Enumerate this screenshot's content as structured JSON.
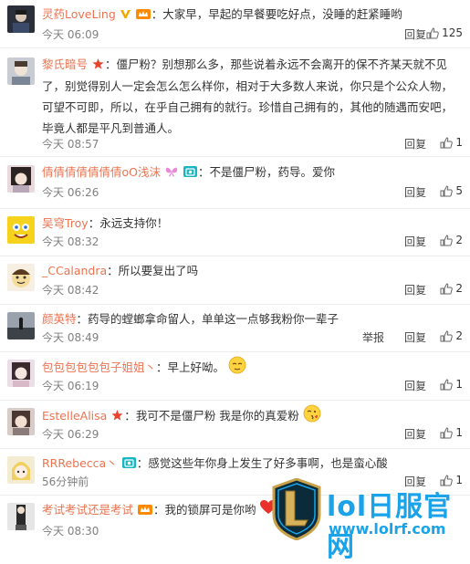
{
  "comments": [
    {
      "user": "灵药LoveLing",
      "text": "大家早，早起的早餐要吃好点，没睡的赶紧睡哟",
      "time": "今天 06:09",
      "reply": "回复",
      "likes": "125",
      "badges": [
        "v-gold",
        "vip"
      ]
    },
    {
      "user": "黎氏暗号",
      "text": "僵尸粉？别想那么多，那些说着永远不会离开的保不齐某天就不见了，别觉得别人一定会怎么怎么样你，相对于大多数人来说，你只是个公众人物，可望不可即，所以，在乎自己拥有的就行。珍惜自己拥有的，其他的随遇而安吧，毕竟人都是平凡到普通人。",
      "time": "今天 08:57",
      "reply": "回复",
      "likes": "1",
      "badges": [
        "star"
      ]
    },
    {
      "user": "倩倩倩倩倩倩倩oO浅沫",
      "text": "不是僵尸粉，药导。爱你",
      "time": "今天 06:26",
      "reply": "回复",
      "likes": "5",
      "badges": [
        "butterfly",
        "camera"
      ]
    },
    {
      "user": "吴穹Troy",
      "text": "永远支持你！",
      "time": "今天 08:32",
      "reply": "回复",
      "likes": "2",
      "badges": []
    },
    {
      "user": "_CCalandra",
      "text": "所以要复出了吗",
      "time": "今天 08:42",
      "reply": "回复",
      "likes": "2",
      "badges": []
    },
    {
      "user": "颜英特",
      "text": "药导的螳螂拿命留人，单单这一点够我粉你一辈子",
      "time": "今天 08:49",
      "report": "举报",
      "reply": "回复",
      "likes": "2",
      "badges": []
    },
    {
      "user": "包包包包包包子姐姐丶",
      "text": "早上好呦。",
      "time": "今天 06:19",
      "reply": "回复",
      "likes": "1",
      "badges": [],
      "emoji": "relieved-emoji"
    },
    {
      "user": "EstelleAlisa",
      "text": "我可不是僵尸粉 我是你的真爱粉",
      "time": "今天 06:29",
      "reply": "回复",
      "likes": "1",
      "badges": [
        "star"
      ],
      "emoji": "kiss-emoji"
    },
    {
      "user": "RRRebecca丶",
      "text": "感觉这些年你身上发生了好多事啊，也是蛮心酸",
      "time": "56分钟前",
      "reply": "回复",
      "likes": "1",
      "badges": [
        "camera"
      ]
    },
    {
      "user": "考试考试还是考试",
      "text": "我的锁屏可是你哟",
      "time": "今天 08:30",
      "reply": "",
      "likes": "",
      "badges": [
        "vip"
      ],
      "emoji": "heart-emoji"
    }
  ],
  "watermark": {
    "title": "lol日服官网",
    "url": "www.lolrf.com"
  },
  "colors": {
    "username": "#eb7350",
    "meta": "#808080",
    "accent": "#1aa3e8"
  }
}
